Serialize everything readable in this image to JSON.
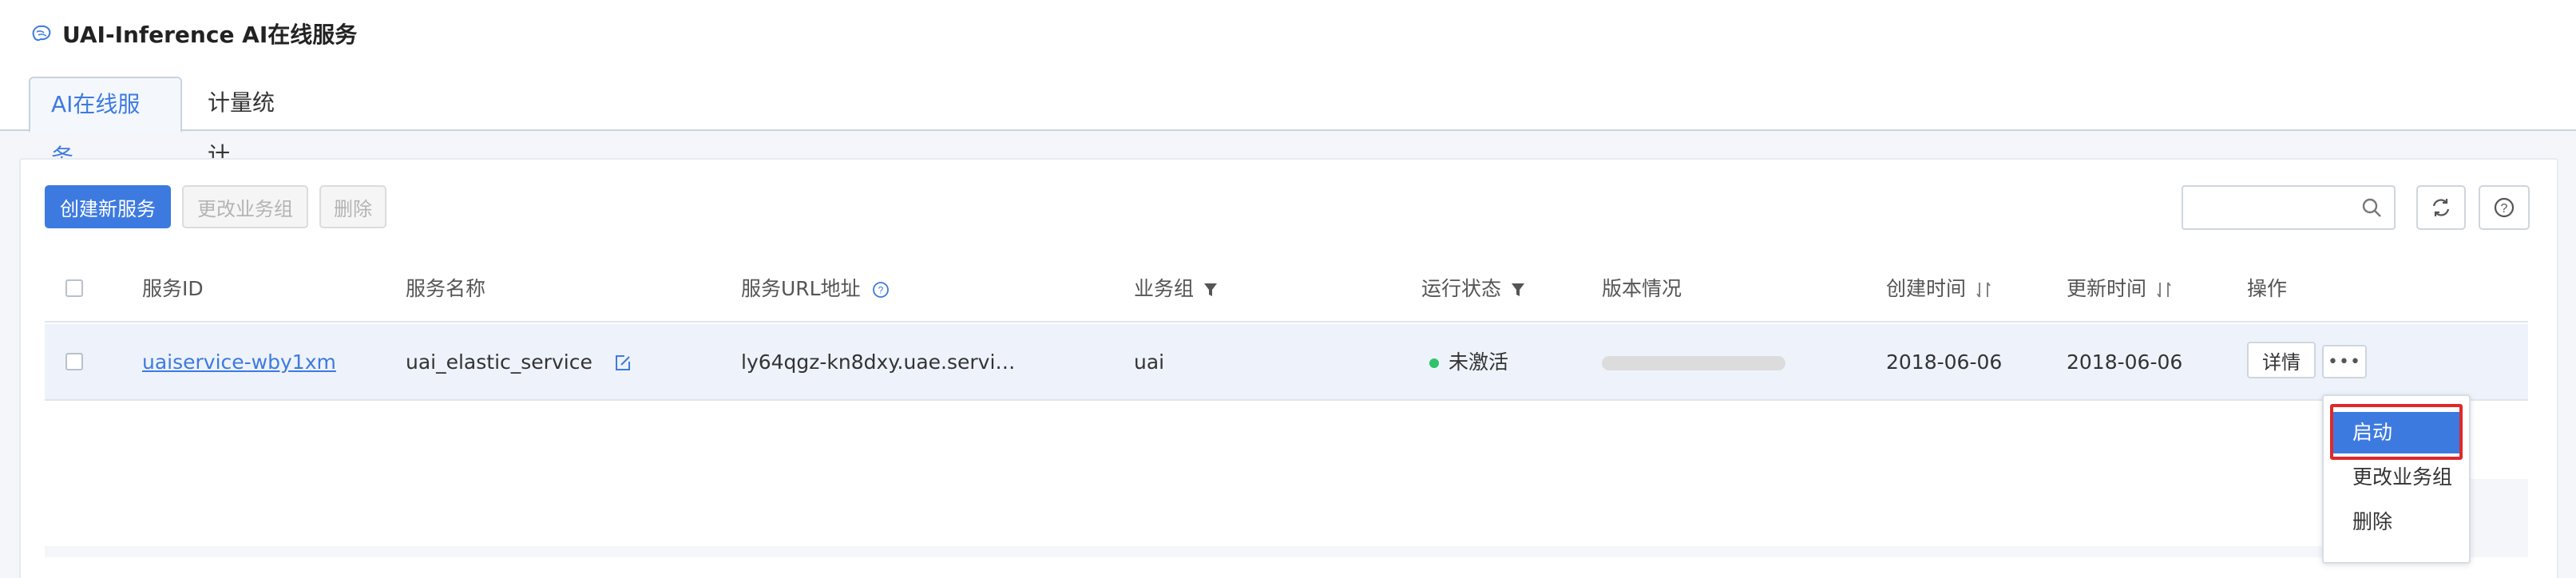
{
  "header": {
    "title": "UAI-Inference AI在线服务"
  },
  "tabs": [
    {
      "label": "AI在线服务"
    },
    {
      "label": "计量统计"
    }
  ],
  "toolbar": {
    "create_label": "创建新服务",
    "change_group_label": "更改业务组",
    "delete_label": "删除",
    "search_placeholder": ""
  },
  "table": {
    "headers": {
      "service_id": "服务ID",
      "service_name": "服务名称",
      "url": "服务URL地址",
      "group": "业务组",
      "status": "运行状态",
      "version": "版本情况",
      "created": "创建时间",
      "updated": "更新时间",
      "actions": "操作"
    },
    "rows": [
      {
        "service_id": "uaiservice-wby1xm",
        "service_name": "uai_elastic_service",
        "url": "ly64qgz-kn8dxy.uae.servi…",
        "group": "uai",
        "status": "未激活",
        "created": "2018-06-06",
        "updated": "2018-06-06",
        "detail_label": "详情",
        "more_label": "•••"
      }
    ]
  },
  "dropdown": {
    "items": [
      {
        "label": "启动"
      },
      {
        "label": "更改业务组"
      },
      {
        "label": "删除"
      }
    ]
  },
  "colors": {
    "accent": "#3d7ae0",
    "status_green": "#2ec36b",
    "highlight_red": "#e02828"
  }
}
